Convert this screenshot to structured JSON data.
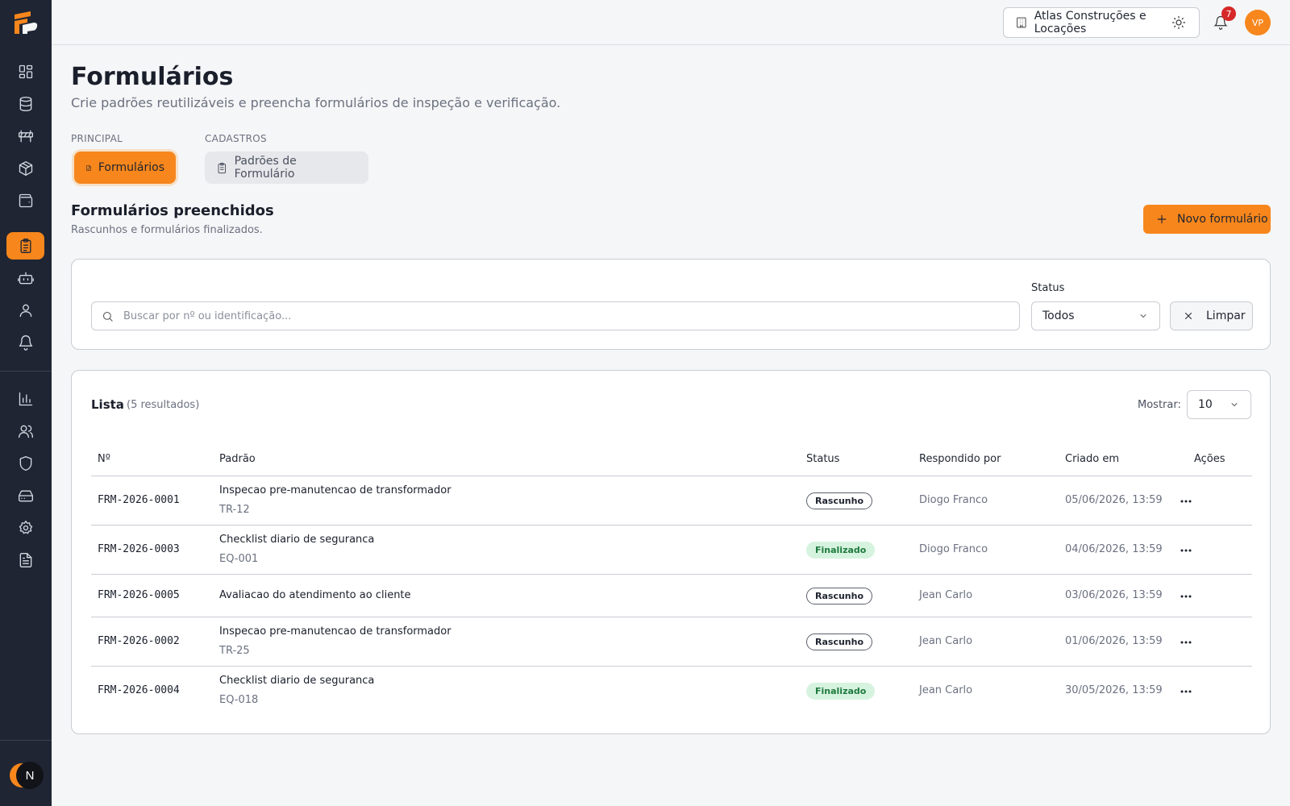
{
  "header": {
    "company": "Atlas Construções e Locações",
    "notification_count": "7",
    "avatar_initials": "VP"
  },
  "sidebar": {
    "icons": [
      "dashboard-icon",
      "database-icon",
      "road-barrier-icon",
      "package-icon",
      "wallet-icon",
      "clipboard-icon",
      "bot-icon",
      "user-icon",
      "bell-icon",
      "chart-icon",
      "users-icon",
      "shield-icon",
      "hard-drive-icon",
      "settings-icon",
      "file-text-icon"
    ],
    "active": "clipboard-icon",
    "bottom_badge": "N"
  },
  "page": {
    "title": "Formulários",
    "subtitle": "Crie padrões reutilizáveis e preencha formulários de inspeção e verificação."
  },
  "tabs": {
    "principal_label": "PRINCIPAL",
    "cadastros_label": "CADASTROS",
    "forms": "Formulários",
    "templates": "Padrões de Formulário"
  },
  "section": {
    "title": "Formulários preenchidos",
    "subtitle": "Rascunhos e formulários finalizados.",
    "new_button": "Novo formulário"
  },
  "filters": {
    "search_placeholder": "Buscar por nº ou identificação...",
    "status_label": "Status",
    "status_value": "Todos",
    "clear_button": "Limpar"
  },
  "list": {
    "title": "Lista",
    "count": "(5 resultados)",
    "show_label": "Mostrar:",
    "show_value": "10",
    "columns": [
      "Nº",
      "Padrão",
      "Status",
      "Respondido por",
      "Criado em",
      "Ações"
    ],
    "rows": [
      {
        "id": "FRM-2026-0001",
        "template": "Inspecao pre-manutencao de transformador",
        "asset": "TR-12",
        "status": "Rascunho",
        "status_type": "draft",
        "user": "Diogo Franco",
        "created": "05/06/2026, 13:59"
      },
      {
        "id": "FRM-2026-0003",
        "template": "Checklist diario de seguranca",
        "asset": "EQ-001",
        "status": "Finalizado",
        "status_type": "done",
        "user": "Diogo Franco",
        "created": "04/06/2026, 13:59"
      },
      {
        "id": "FRM-2026-0005",
        "template": "Avaliacao do atendimento ao cliente",
        "asset": "",
        "status": "Rascunho",
        "status_type": "draft",
        "user": "Jean Carlo",
        "created": "03/06/2026, 13:59"
      },
      {
        "id": "FRM-2026-0002",
        "template": "Inspecao pre-manutencao de transformador",
        "asset": "TR-25",
        "status": "Rascunho",
        "status_type": "draft",
        "user": "Jean Carlo",
        "created": "01/06/2026, 13:59"
      },
      {
        "id": "FRM-2026-0004",
        "template": "Checklist diario de seguranca",
        "asset": "EQ-018",
        "status": "Finalizado",
        "status_type": "done",
        "user": "Jean Carlo",
        "created": "30/05/2026, 13:59"
      }
    ]
  },
  "colors": {
    "accent": "#f7861c",
    "sidebar": "#1f2533",
    "success_bg": "#d6f3df",
    "success_text": "#1f7a3e",
    "notification": "#d62828"
  }
}
